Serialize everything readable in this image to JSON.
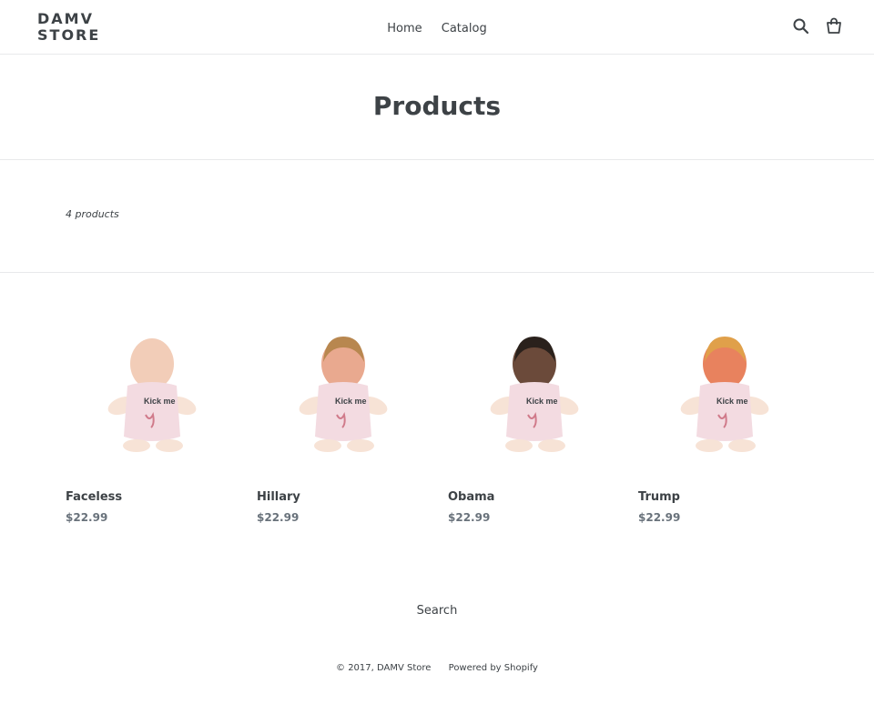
{
  "header": {
    "logo_line1": "DAMV",
    "logo_line2": "STORE",
    "nav": [
      "Home",
      "Catalog"
    ],
    "icons": [
      "search-icon",
      "cart-icon"
    ]
  },
  "page": {
    "title": "Products",
    "product_count": "4 products"
  },
  "products": [
    {
      "name": "Faceless",
      "price": "$22.99",
      "face": "blank"
    },
    {
      "name": "Hillary",
      "price": "$22.99",
      "face": "blonde"
    },
    {
      "name": "Obama",
      "price": "$22.99",
      "face": "dark"
    },
    {
      "name": "Trump",
      "price": "$22.99",
      "face": "orange"
    }
  ],
  "shirt_print": "Kick me",
  "footer": {
    "search_link": "Search",
    "copyright": "© 2017, DAMV Store",
    "powered": "Powered by Shopify"
  },
  "colors": {
    "text": "#3d4246",
    "price": "#69727b",
    "border": "#e8e9eb",
    "shirt": "#f3dbe1",
    "skin": "#f7e3d6"
  }
}
